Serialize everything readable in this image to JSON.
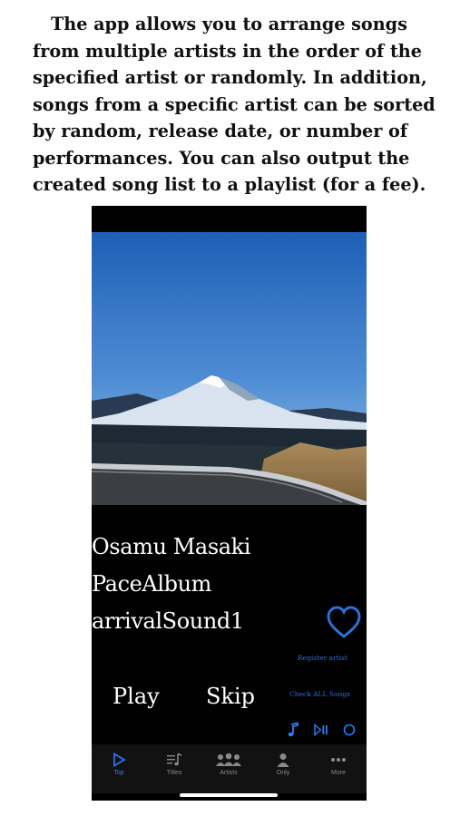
{
  "description": "The app allows you to arrange songs from multiple artists in the order of the specified artist or randomly. In addition, songs from a specific artist can be sorted by random, release date, or number of performances. You can also output the created song list to a playlist (for a fee).",
  "now_playing": {
    "artist": "Osamu Masaki",
    "album": "PaceAlbum",
    "song": "arrivalSound1"
  },
  "actions": {
    "register_artist": "Register artist",
    "check_all_songs": "Check ALL Songs",
    "play": "Play",
    "skip": "Skip"
  },
  "controls": [
    "music-note-icon",
    "play-pause-icon",
    "repeat-icon"
  ],
  "tabs": [
    {
      "label": "Top",
      "icon": "play-icon",
      "active": true
    },
    {
      "label": "Titles",
      "icon": "titles-icon",
      "active": false
    },
    {
      "label": "Artists",
      "icon": "artists-icon",
      "active": false
    },
    {
      "label": "Only",
      "icon": "person-icon",
      "active": false
    },
    {
      "label": "More",
      "icon": "more-icon",
      "active": false
    }
  ],
  "colors": {
    "accent": "#2f7df6",
    "heart": "#2f6fd6",
    "background": "#000000",
    "tab_bar": "#121212"
  }
}
